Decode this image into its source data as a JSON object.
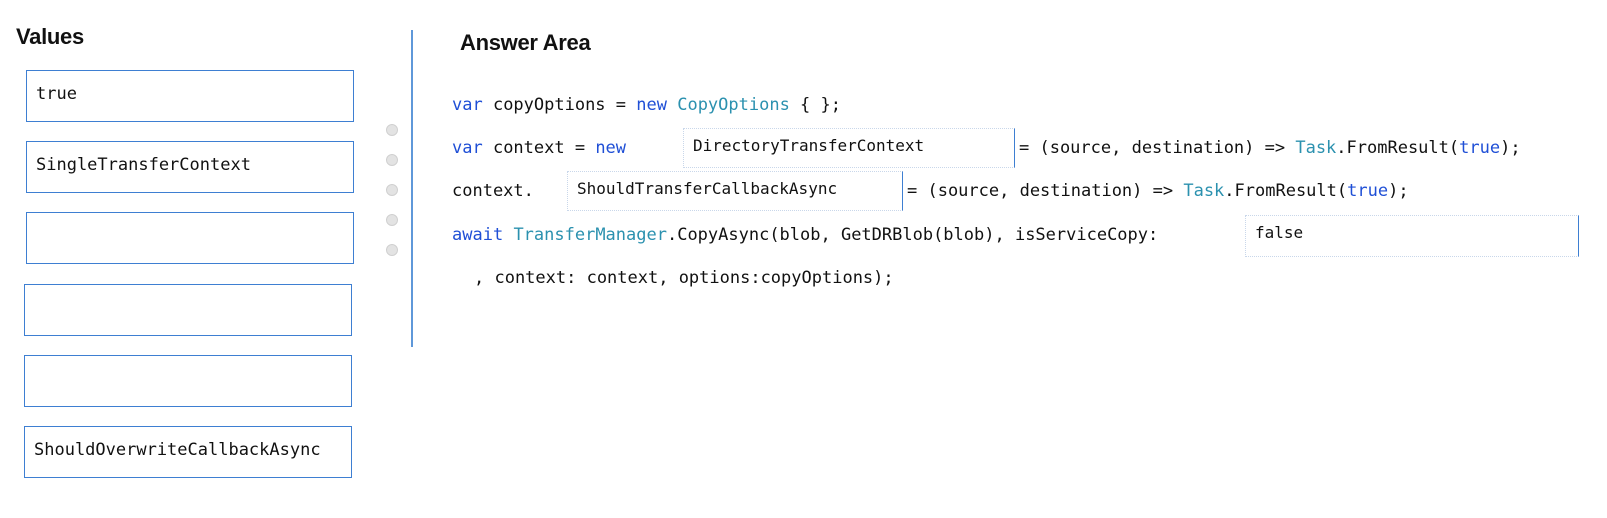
{
  "values_panel": {
    "heading": "Values",
    "items": [
      "true",
      "SingleTransferContext",
      "",
      "",
      "",
      "ShouldOverwriteCallbackAsync"
    ]
  },
  "answer_area": {
    "heading": "Answer Area",
    "line1": {
      "kw1": "var",
      "t1": " copyOptions = ",
      "kw2": "new",
      "sp": " ",
      "ty1": "CopyOptions",
      "t2": " { };"
    },
    "line2": {
      "kw1": "var",
      "t1": " context = ",
      "kw2": "new",
      "t2": "= (source, destination) => ",
      "ty1": "Task",
      "t3": ".FromResult(",
      "kw3": "true",
      "t4": ");"
    },
    "line3": {
      "t1": "context.",
      "t2": "= (source, destination) => ",
      "ty1": "Task",
      "t3": ".FromResult(",
      "kw3": "true",
      "t4": ");"
    },
    "line4": {
      "kw1": "await",
      "sp": " ",
      "ty1": "TransferManager",
      "t1": ".CopyAsync(blob, GetDRBlob(blob), isServiceCopy:"
    },
    "line5": {
      "t1": ", context: context, options:copyOptions);"
    },
    "slots": {
      "context_type": "DirectoryTransferContext",
      "callback": "ShouldTransferCallbackAsync",
      "service_copy": "false"
    }
  },
  "colors": {
    "keyword": "#1f4fd6",
    "type": "#2b91af",
    "slot_border": "#3e7fd2"
  }
}
